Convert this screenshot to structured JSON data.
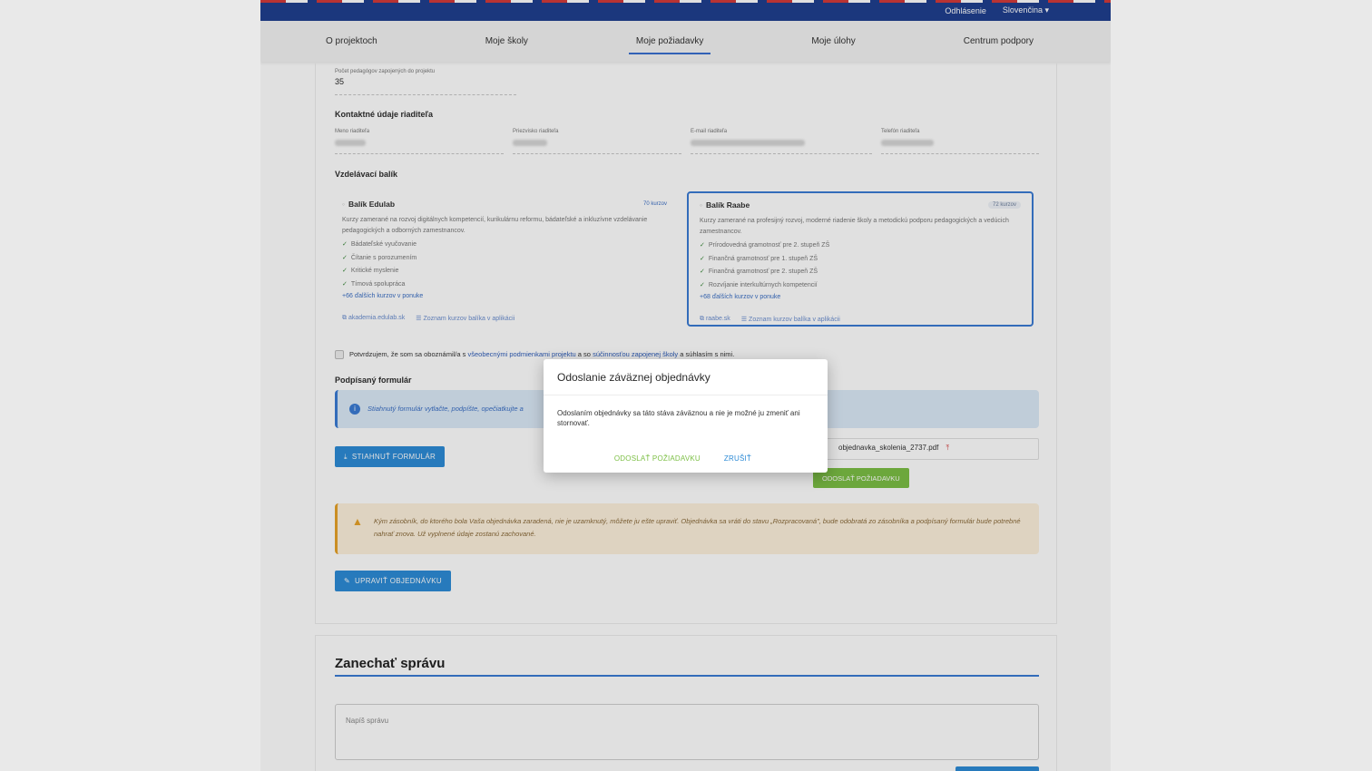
{
  "topbar": {
    "logout": "Odhlásenie",
    "language": "Slovenčina"
  },
  "nav": {
    "tabs": [
      "O projektoch",
      "Moje školy",
      "Moje požiadavky",
      "Moje úlohy",
      "Centrum podpory"
    ]
  },
  "form": {
    "teachers_label": "Počet pedagógov zapojených do projektu",
    "teachers_value": "35",
    "contact_heading": "Kontaktné údaje riaditeľa",
    "director_first_label": "Meno riaditeľa",
    "director_last_label": "Priezvisko riaditeľa",
    "director_email_label": "E-mail riaditeľa",
    "director_phone_label": "Telefón riaditeľa",
    "package_heading": "Vzdelávací balík",
    "packages": [
      {
        "title": "Balík Edulab",
        "count": "70 kurzov",
        "description": "Kurzy zamerané na rozvoj digitálnych kompetencií, kurikulárnu reformu, bádateľské a inkluzívne vzdelávanie pedagogických a odborných zamestnancov.",
        "items": [
          "Bádateľské vyučovanie",
          "Čítanie s porozumením",
          "Kritické myslenie",
          "Tímová spolupráca"
        ],
        "more": "+66 ďalších kurzov v ponuke",
        "link1": "akademia.edulab.sk",
        "link2": "Zoznam kurzov balíka v aplikácii"
      },
      {
        "title": "Balík Raabe",
        "count": "72 kurzov",
        "description": "Kurzy zamerané na profesijný rozvoj, moderné riadenie školy a metodickú podporu pedagogických a vedúcich zamestnancov.",
        "items": [
          "Prírodovedná gramotnosť pre 2. stupeň ZŠ",
          "Finančná gramotnosť pre 1. stupeň ZŠ",
          "Finančná gramotnosť pre 2. stupeň ZŠ",
          "Rozvíjanie interkultúrnych kompetencií"
        ],
        "more": "+68 ďalších kurzov v ponuke",
        "link1": "raabe.sk",
        "link2": "Zoznam kurzov balíka v aplikácii"
      }
    ],
    "confirm_prefix": "Potvrdzujem, že som sa oboznámil/a s ",
    "confirm_link1": "všeobecnými podmienkami projektu",
    "confirm_mid": " a so ",
    "confirm_link2": "súčinnosťou zapojenej školy",
    "confirm_suffix": " a súhlasím s nimi.",
    "signed_heading": "Podpísaný formulár",
    "info_text": "Stiahnutý formulár vytlačte, podpíšte, opečiatkujte a",
    "download_button": "STIAHNUŤ FORMULÁR",
    "file_name": "objednavka_skolenia_2737.pdf",
    "send_button": "ODOSLAŤ POŽIADAVKU",
    "warning_text": "Kým zásobník, do ktorého bola Vaša objednávka zaradená, nie je uzamknutý, môžete ju ešte upraviť. Objednávka sa vráti do stavu „Rozpracovaná\", bude odobratá zo zásobníka a podpísaný formulár bude potrebné nahrať znova. Už vyplnené údaje zostanú zachované.",
    "edit_button": "UPRAVIŤ OBJEDNÁVKU"
  },
  "message": {
    "title": "Zanechať správu",
    "placeholder": "Napíš správu"
  },
  "modal": {
    "title": "Odoslanie záväznej objednávky",
    "body": "Odoslaním objednávky sa táto stáva záväznou a nie je možné ju zmeniť ani stornovať.",
    "confirm": "ODOSLAŤ POŽIADAVKU",
    "cancel": "ZRUŠIŤ"
  },
  "colors": {
    "primary": "#2d8bd6",
    "success": "#7cbf45",
    "header": "#1f3f8f",
    "warning": "#e6a22a"
  }
}
